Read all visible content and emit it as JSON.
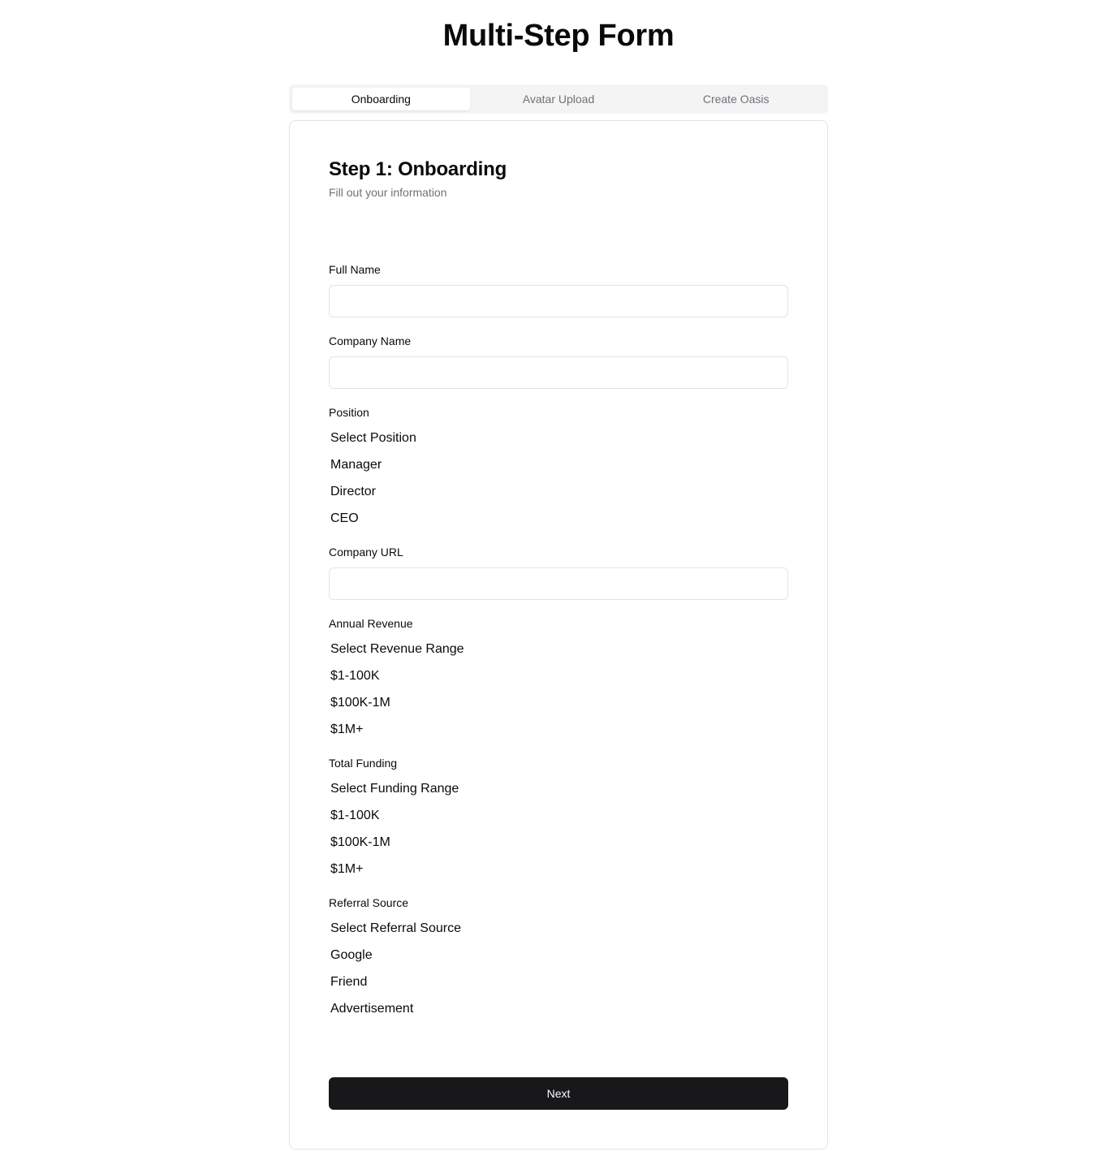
{
  "page": {
    "title": "Multi-Step Form"
  },
  "tabs": [
    {
      "label": "Onboarding",
      "active": true
    },
    {
      "label": "Avatar Upload",
      "active": false
    },
    {
      "label": "Create Oasis",
      "active": false
    }
  ],
  "card": {
    "title": "Step 1: Onboarding",
    "subtitle": "Fill out your information"
  },
  "fields": {
    "full_name": {
      "label": "Full Name",
      "value": "",
      "placeholder": ""
    },
    "company_name": {
      "label": "Company Name",
      "value": "",
      "placeholder": ""
    },
    "position": {
      "label": "Position",
      "options": [
        "Select Position",
        "Manager",
        "Director",
        "CEO"
      ]
    },
    "company_url": {
      "label": "Company URL",
      "value": "",
      "placeholder": ""
    },
    "annual_revenue": {
      "label": "Annual Revenue",
      "options": [
        "Select Revenue Range",
        "$1-100K",
        "$100K-1M",
        "$1M+"
      ]
    },
    "total_funding": {
      "label": "Total Funding",
      "options": [
        "Select Funding Range",
        "$1-100K",
        "$100K-1M",
        "$1M+"
      ]
    },
    "referral_source": {
      "label": "Referral Source",
      "options": [
        "Select Referral Source",
        "Google",
        "Friend",
        "Advertisement"
      ]
    }
  },
  "actions": {
    "next_label": "Next"
  },
  "colors": {
    "primary_button": "#18181b",
    "border": "#e4e4e7",
    "muted_text": "#71717a",
    "tab_background": "#f4f4f5"
  }
}
